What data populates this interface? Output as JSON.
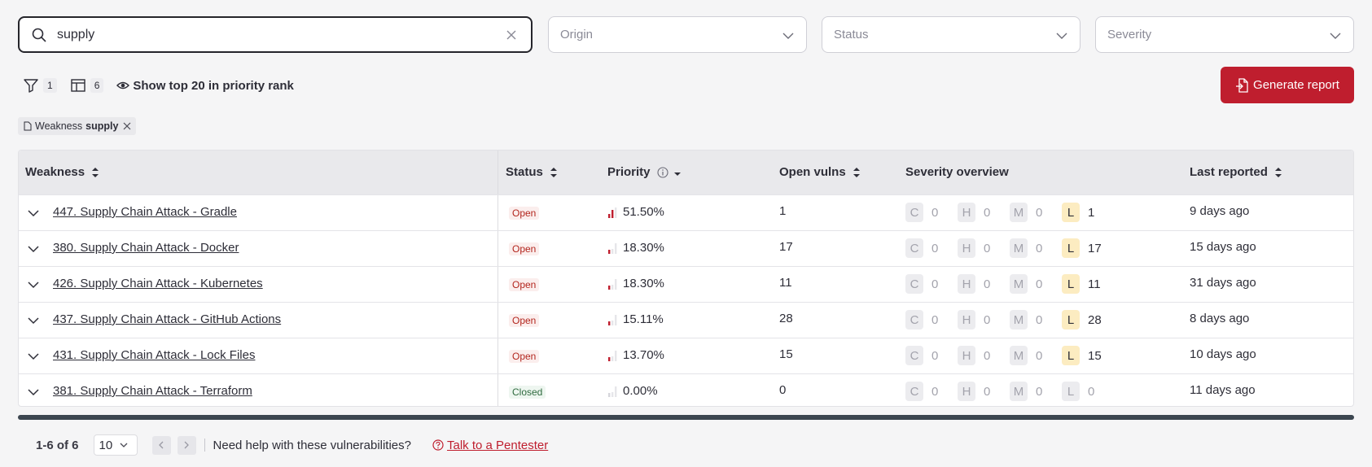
{
  "search": {
    "value": "supply"
  },
  "filters": {
    "origin_placeholder": "Origin",
    "status_placeholder": "Status",
    "severity_placeholder": "Severity"
  },
  "toolbar": {
    "filter_count": "1",
    "columns_count": "6",
    "top20_label": "Show top 20 in priority rank",
    "generate_label": "Generate report"
  },
  "chip": {
    "prefix": "Weakness",
    "value": "supply"
  },
  "table": {
    "headers": {
      "weakness": "Weakness",
      "status": "Status",
      "priority": "Priority",
      "open_vulns": "Open vulns",
      "severity": "Severity overview",
      "last_reported": "Last reported"
    },
    "severity_letters": [
      "C",
      "H",
      "M",
      "L"
    ],
    "rows": [
      {
        "weakness": "447. Supply Chain Attack - Gradle",
        "status": "Open",
        "priority": "51.50%",
        "open_vulns": "1",
        "sev": [
          "0",
          "0",
          "0",
          "1"
        ],
        "last": "9 days ago"
      },
      {
        "weakness": "380. Supply Chain Attack - Docker",
        "status": "Open",
        "priority": "18.30%",
        "open_vulns": "17",
        "sev": [
          "0",
          "0",
          "0",
          "17"
        ],
        "last": "15 days ago"
      },
      {
        "weakness": "426. Supply Chain Attack - Kubernetes",
        "status": "Open",
        "priority": "18.30%",
        "open_vulns": "11",
        "sev": [
          "0",
          "0",
          "0",
          "11"
        ],
        "last": "31 days ago"
      },
      {
        "weakness": "437. Supply Chain Attack - GitHub Actions",
        "status": "Open",
        "priority": "15.11%",
        "open_vulns": "28",
        "sev": [
          "0",
          "0",
          "0",
          "28"
        ],
        "last": "8 days ago"
      },
      {
        "weakness": "431. Supply Chain Attack - Lock Files",
        "status": "Open",
        "priority": "13.70%",
        "open_vulns": "15",
        "sev": [
          "0",
          "0",
          "0",
          "15"
        ],
        "last": "10 days ago"
      },
      {
        "weakness": "381. Supply Chain Attack - Terraform",
        "status": "Closed",
        "priority": "0.00%",
        "open_vulns": "0",
        "sev": [
          "0",
          "0",
          "0",
          "0"
        ],
        "last": "11 days ago"
      }
    ]
  },
  "pager": {
    "range": "1-6 of 6",
    "page_size": "10",
    "help_text": "Need help with these vulnerabilities?",
    "pentester_link": "Talk to a Pentester"
  },
  "colors": {
    "accent": "#bf1e2e",
    "low_badge": "#fcecc1",
    "header_bg": "#e9e9ec"
  }
}
